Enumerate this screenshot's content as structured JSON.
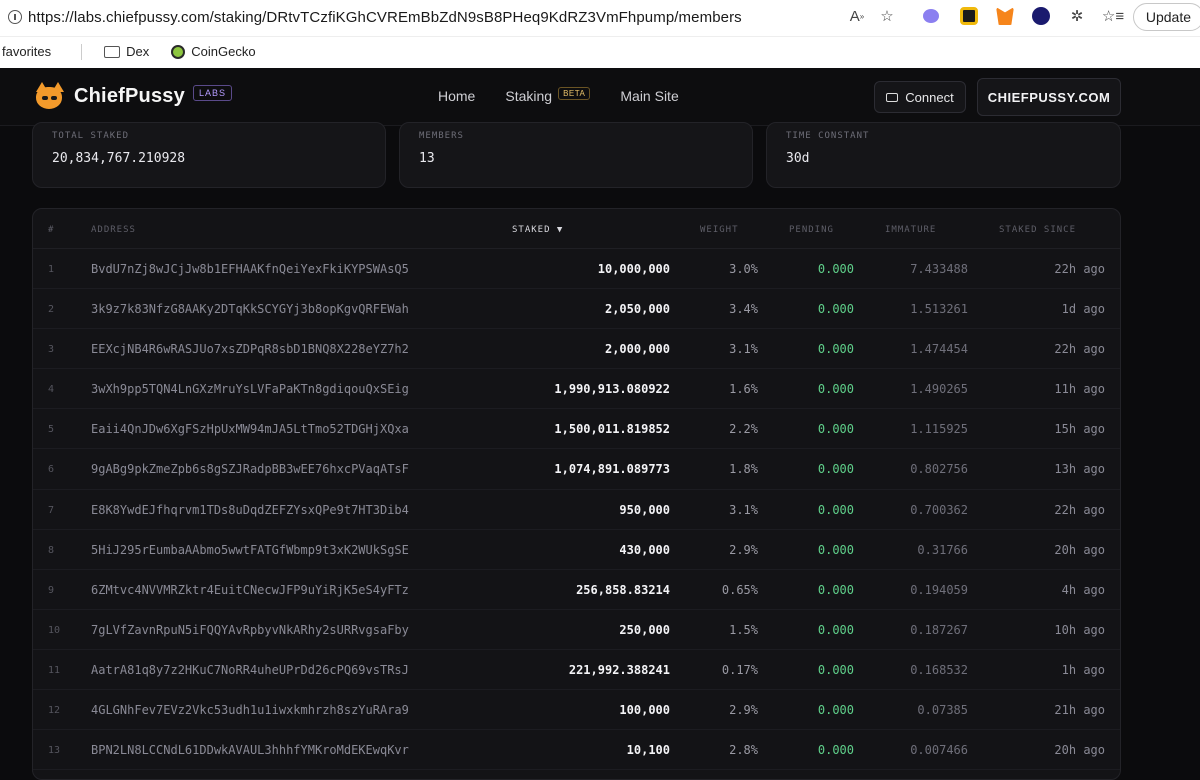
{
  "browser": {
    "url": "https://labs.chiefpussy.com/staking/DRtvTCzfiKGhCVREmBbZdN9sB8PHeq9KdRZ3VmFhpump/members",
    "update_label": "Update",
    "favorites": [
      {
        "label": "favorites"
      },
      {
        "label": "Dex"
      },
      {
        "label": "CoinGecko"
      }
    ]
  },
  "header": {
    "brand": "ChiefPussy",
    "labs_badge": "LABS",
    "nav": [
      {
        "label": "Home"
      },
      {
        "label": "Staking",
        "badge": "BETA"
      },
      {
        "label": "Main Site"
      }
    ],
    "connect_label": "Connect",
    "site_label": "CHIEFPUSSY.COM"
  },
  "stats": [
    {
      "label": "TOTAL STAKED",
      "value": "20,834,767.210928"
    },
    {
      "label": "MEMBERS",
      "value": "13"
    },
    {
      "label": "TIME CONSTANT",
      "value": "30d"
    }
  ],
  "table": {
    "columns": {
      "index": "#",
      "address": "ADDRESS",
      "staked": "STAKED ▼",
      "weight": "WEIGHT",
      "pending": "PENDING",
      "immature": "IMMATURE",
      "since": "STAKED SINCE"
    },
    "rows": [
      {
        "index": "1",
        "address": "BvdU7nZj8wJCjJw8b1EFHAAKfnQeiYexFkiKYPSWAsQ5",
        "staked": "10,000,000",
        "weight": "3.0%",
        "pending": "0.000",
        "immature": "7.433488",
        "since": "22h ago"
      },
      {
        "index": "2",
        "address": "3k9z7k83NfzG8AAKy2DTqKkSCYGYj3b8opKgvQRFEWah",
        "staked": "2,050,000",
        "weight": "3.4%",
        "pending": "0.000",
        "immature": "1.513261",
        "since": "1d ago"
      },
      {
        "index": "3",
        "address": "EEXcjNB4R6wRASJUo7xsZDPqR8sbD1BNQ8X228eYZ7h2",
        "staked": "2,000,000",
        "weight": "3.1%",
        "pending": "0.000",
        "immature": "1.474454",
        "since": "22h ago"
      },
      {
        "index": "4",
        "address": "3wXh9pp5TQN4LnGXzMruYsLVFaPaKTn8gdiqouQxSEig",
        "staked": "1,990,913.080922",
        "weight": "1.6%",
        "pending": "0.000",
        "immature": "1.490265",
        "since": "11h ago"
      },
      {
        "index": "5",
        "address": "Eaii4QnJDw6XgFSzHpUxMW94mJA5LtTmo52TDGHjXQxa",
        "staked": "1,500,011.819852",
        "weight": "2.2%",
        "pending": "0.000",
        "immature": "1.115925",
        "since": "15h ago"
      },
      {
        "index": "6",
        "address": "9gABg9pkZmeZpb6s8gSZJRadpBB3wEE76hxcPVaqATsF",
        "staked": "1,074,891.089773",
        "weight": "1.8%",
        "pending": "0.000",
        "immature": "0.802756",
        "since": "13h ago"
      },
      {
        "index": "7",
        "address": "E8K8YwdEJfhqrvm1TDs8uDqdZEFZYsxQPe9t7HT3Dib4",
        "staked": "950,000",
        "weight": "3.1%",
        "pending": "0.000",
        "immature": "0.700362",
        "since": "22h ago"
      },
      {
        "index": "8",
        "address": "5HiJ295rEumbaAAbmo5wwtFATGfWbmp9t3xK2WUkSgSE",
        "staked": "430,000",
        "weight": "2.9%",
        "pending": "0.000",
        "immature": "0.31766",
        "since": "20h ago"
      },
      {
        "index": "9",
        "address": "6ZMtvc4NVVMRZktr4EuitCNecwJFP9uYiRjK5eS4yFTz",
        "staked": "256,858.83214",
        "weight": "0.65%",
        "pending": "0.000",
        "immature": "0.194059",
        "since": "4h ago"
      },
      {
        "index": "10",
        "address": "7gLVfZavnRpuN5iFQQYAvRpbyvNkARhy2sURRvgsaFby",
        "staked": "250,000",
        "weight": "1.5%",
        "pending": "0.000",
        "immature": "0.187267",
        "since": "10h ago"
      },
      {
        "index": "11",
        "address": "AatrA81q8y7z2HKuC7NoRR4uheUPrDd26cPQ69vsTRsJ",
        "staked": "221,992.388241",
        "weight": "0.17%",
        "pending": "0.000",
        "immature": "0.168532",
        "since": "1h ago"
      },
      {
        "index": "12",
        "address": "4GLGNhFev7EVz2Vkc53udh1u1iwxkmhrzh8szYuRAra9",
        "staked": "100,000",
        "weight": "2.9%",
        "pending": "0.000",
        "immature": "0.07385",
        "since": "21h ago"
      },
      {
        "index": "13",
        "address": "BPN2LN8LCCNdL61DDwkAVAUL3hhhfYMKroMdEKEwqKvr",
        "staked": "10,100",
        "weight": "2.8%",
        "pending": "0.000",
        "immature": "0.007466",
        "since": "20h ago"
      }
    ]
  },
  "colors": {
    "accent_pending": "#5fd08a",
    "brand_orange": "#f39a2b",
    "labs_purple": "#b49cff",
    "beta_gold": "#e9c26b"
  }
}
